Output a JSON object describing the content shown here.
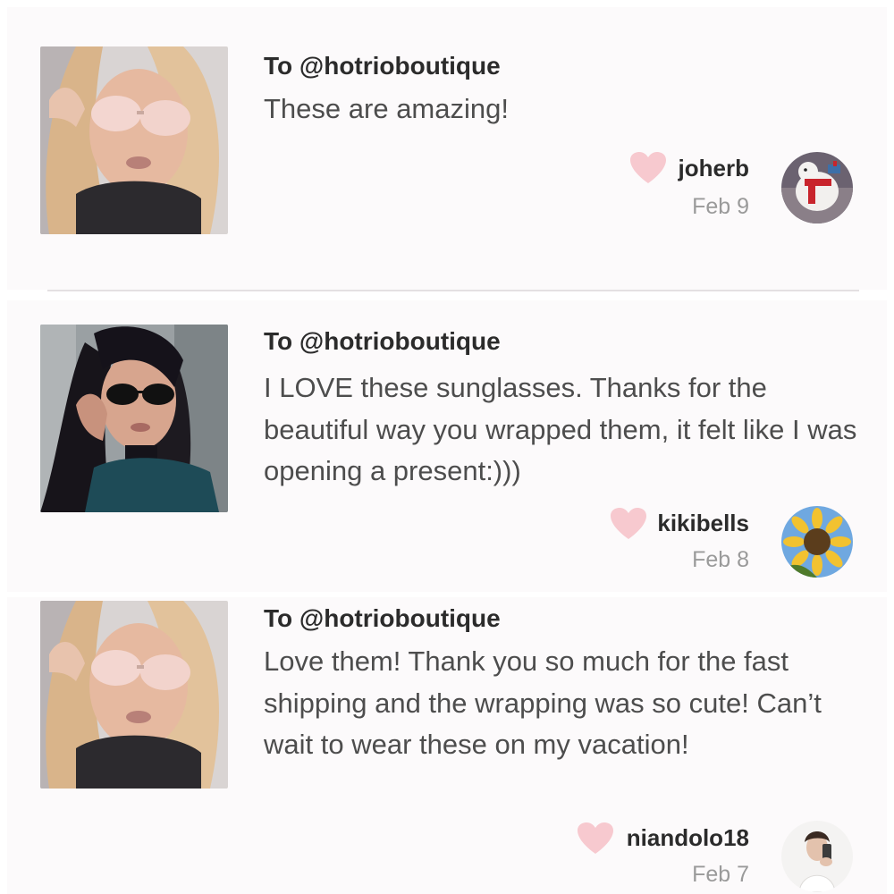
{
  "colors": {
    "card_background": "#fcfafb",
    "heart": "#f7c9cf",
    "username": "#2b2b2b",
    "message": "#4d4d4d",
    "date": "#9a9a9a",
    "divider": "#e4e0e2"
  },
  "reviews": [
    {
      "recipient": "To @hotrioboutique",
      "message": "These are amazing!",
      "username": "joherb",
      "date": "Feb 9",
      "product_image": "woman-with-rose-gold-mirrored-sunglasses",
      "avatar_image": "polar-bear-with-red-scarf",
      "heart_icon": "heart-icon"
    },
    {
      "recipient": "To @hotrioboutique",
      "message": "I LOVE these sunglasses. Thanks for the beautiful way you wrapped them, it felt like I was opening a present:)))",
      "username": "kikibells",
      "date": "Feb 8",
      "product_image": "woman-with-black-cat-eye-sunglasses",
      "avatar_image": "sunflower",
      "heart_icon": "heart-icon"
    },
    {
      "recipient": "To @hotrioboutique",
      "message": "Love them! Thank you so much for the fast shipping and the wrapping was so cute! Can’t wait to wear these on my vacation!",
      "username": "niandolo18",
      "date": "Feb 7",
      "product_image": "woman-with-rose-gold-mirrored-sunglasses",
      "avatar_image": "person-taking-selfie",
      "heart_icon": "heart-icon"
    }
  ]
}
